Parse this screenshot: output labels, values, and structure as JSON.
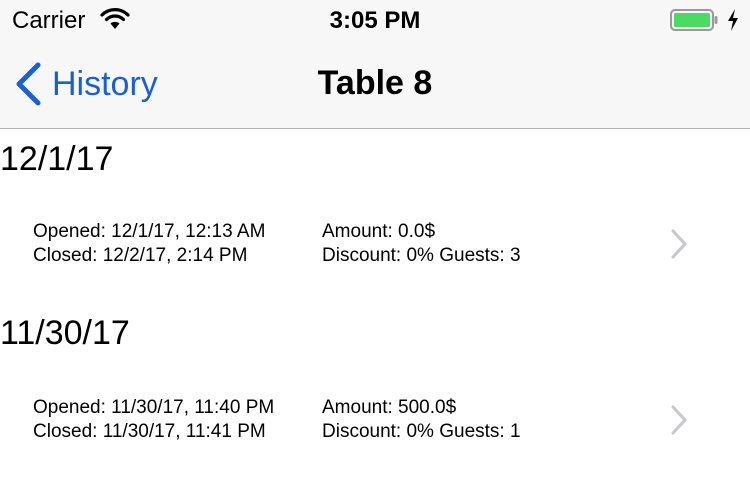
{
  "status_bar": {
    "carrier": "Carrier",
    "time": "3:05 PM",
    "wifi_icon": "wifi-icon",
    "battery_icon": "battery-icon",
    "battery_color": "#4cd964",
    "charging_icon": "lightning-icon"
  },
  "nav": {
    "back_label": "History",
    "title": "Table 8",
    "accent": "#1b5fd1"
  },
  "sections": [
    {
      "header": "12/1/17",
      "row": {
        "opened": "Opened: 12/1/17, 12:13 AM",
        "closed": "Closed: 12/2/17, 2:14 PM",
        "amount": "Amount:  0.0$",
        "discount_guests": "Discount: 0% Guests: 3"
      }
    },
    {
      "header": "11/30/17",
      "row": {
        "opened": "Opened: 11/30/17, 11:40 PM",
        "closed": "Closed: 11/30/17, 11:41 PM",
        "amount": "Amount:  500.0$",
        "discount_guests": "Discount: 0% Guests: 1"
      }
    }
  ]
}
